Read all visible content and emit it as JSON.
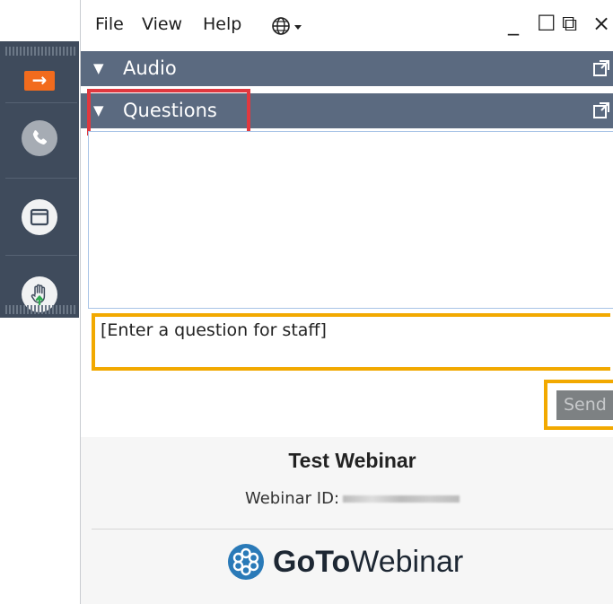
{
  "menu": {
    "file": "File",
    "view": "View",
    "help": "Help",
    "language_icon": "globe-icon"
  },
  "window_controls": {
    "minimize": "_",
    "maximize": "☐",
    "popout": "⧉",
    "close": "×"
  },
  "grab_tab": {
    "collapse_icon": "arrow-right-icon",
    "items": [
      "phone-icon",
      "screen-icon",
      "raise-hand-icon"
    ]
  },
  "panes": {
    "audio": {
      "label": "Audio",
      "expanded_marker": "▼"
    },
    "questions": {
      "label": "Questions",
      "expanded_marker": "▼"
    }
  },
  "question_box": {
    "text": "[Enter a question for staff]"
  },
  "send_button": {
    "label": "Send"
  },
  "webinar": {
    "title": "Test Webinar",
    "id_label": "Webinar ID:"
  },
  "brand": {
    "goto": "GoTo",
    "webinar": "Webinar"
  },
  "colors": {
    "grab_tab_bg": "#3f4b5c",
    "header_bg": "#5b6a80",
    "accent_orange": "#f26b1d",
    "highlight_yellow": "#f2a900",
    "highlight_red": "#e0383f",
    "brand_blue": "#2a7ab8"
  }
}
